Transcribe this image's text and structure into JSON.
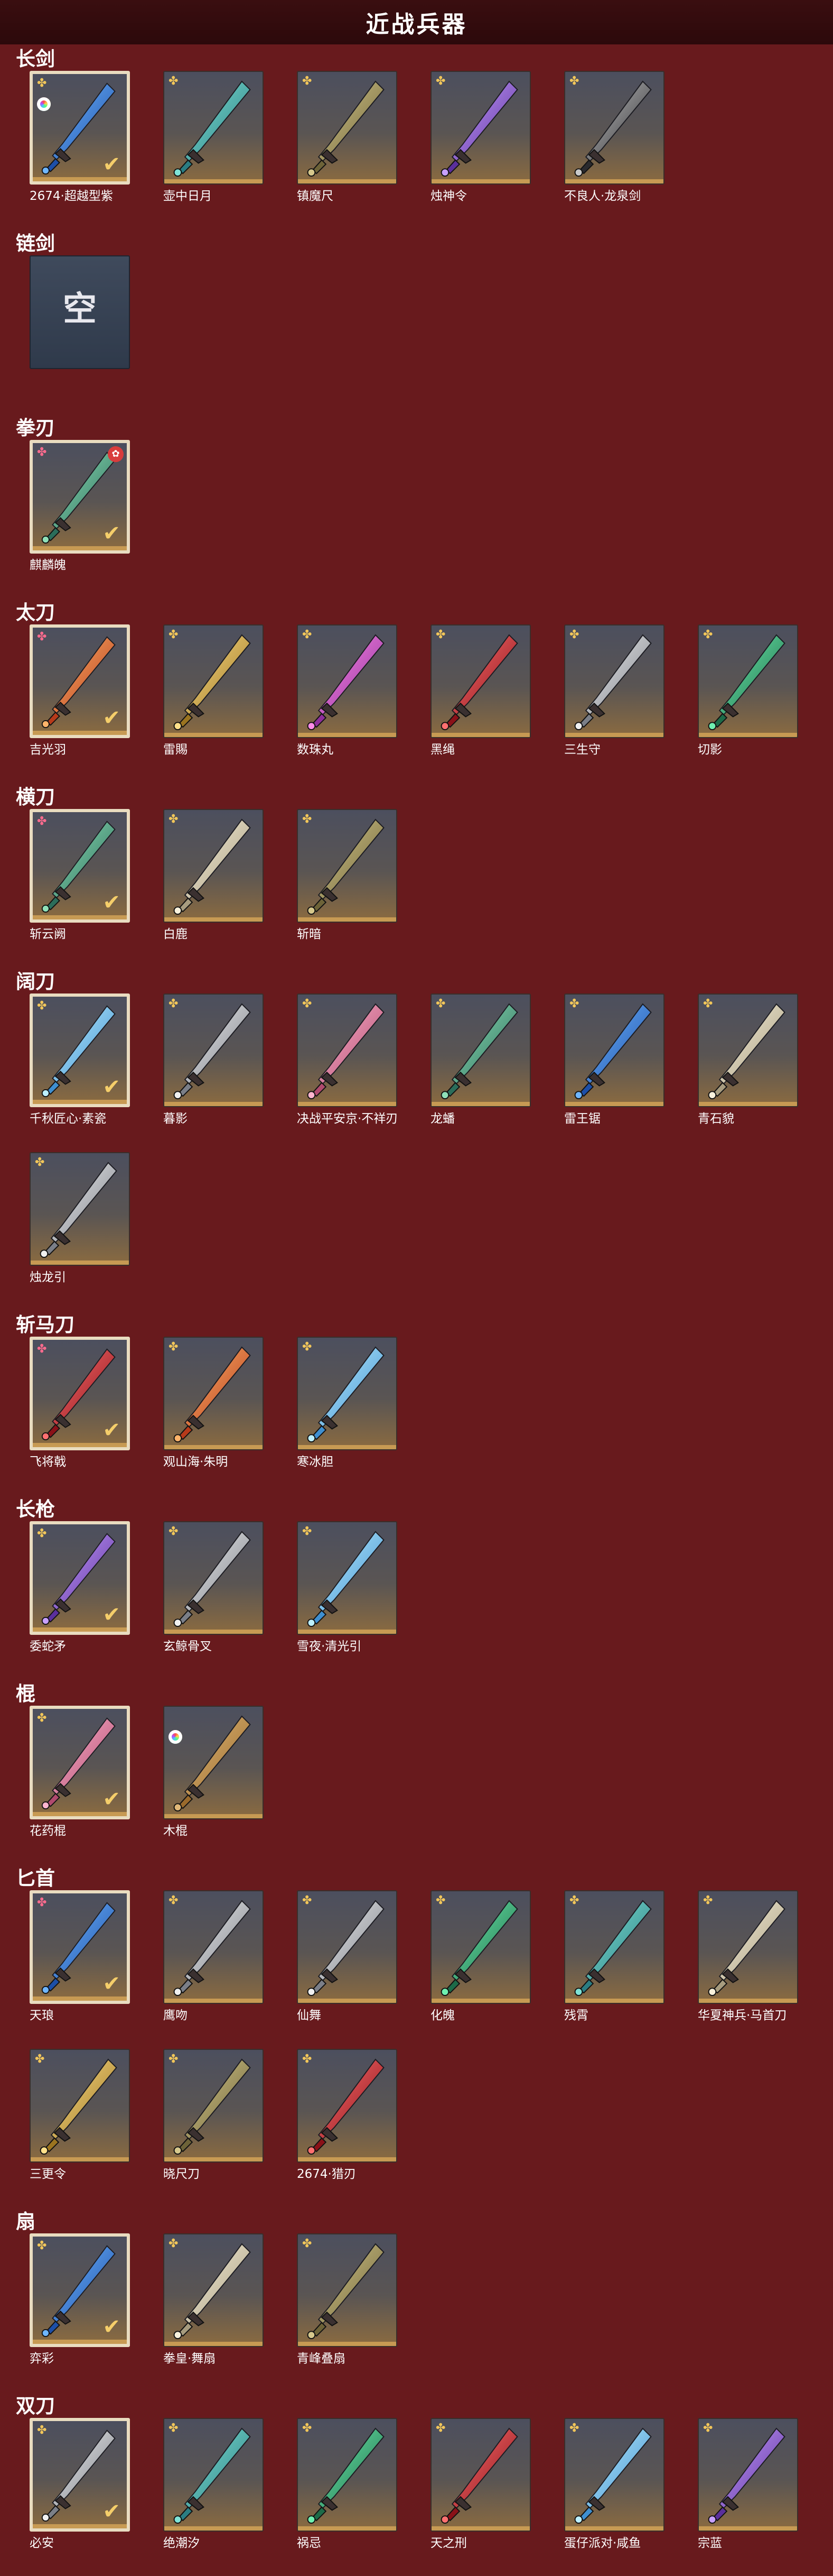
{
  "header": {
    "title": "近战兵器"
  },
  "colors": {
    "background": "#681a1d",
    "header": "#2c090b",
    "card_base": "#c79a53",
    "check": "#f5ce6a",
    "rarity_gold": "#f1c65a",
    "rarity_red": "#ff6b8e"
  },
  "categories": [
    {
      "title": "长剑",
      "items": [
        {
          "name": "2674·超越型紫",
          "rarity": "gold",
          "selected": true,
          "badge": "rainbow-left",
          "palette": "blue"
        },
        {
          "name": "壶中日月",
          "rarity": "gold",
          "palette": "teal"
        },
        {
          "name": "镇魔尺",
          "rarity": "gold",
          "palette": "olive"
        },
        {
          "name": "烛神令",
          "rarity": "gold",
          "palette": "violet"
        },
        {
          "name": "不良人·龙泉剑",
          "rarity": "gold",
          "palette": "dark"
        }
      ]
    },
    {
      "title": "链剑",
      "items": [
        {
          "name": "",
          "empty": true,
          "empty_text": "空"
        }
      ]
    },
    {
      "title": "拳刃",
      "items": [
        {
          "name": "麒麟魄",
          "rarity": "red",
          "selected": true,
          "badge": "limited",
          "palette": "jade"
        }
      ]
    },
    {
      "title": "太刀",
      "items": [
        {
          "name": "吉光羽",
          "rarity": "red",
          "selected": true,
          "palette": "fire"
        },
        {
          "name": "雷賜",
          "rarity": "gold",
          "palette": "gold"
        },
        {
          "name": "数珠丸",
          "rarity": "gold",
          "palette": "magenta"
        },
        {
          "name": "黑绳",
          "rarity": "gold",
          "palette": "crimson"
        },
        {
          "name": "三生守",
          "rarity": "gold",
          "palette": "silver"
        },
        {
          "name": "切影",
          "rarity": "gold",
          "palette": "emerald"
        }
      ]
    },
    {
      "title": "横刀",
      "items": [
        {
          "name": "斩云阙",
          "rarity": "red",
          "selected": true,
          "palette": "jade"
        },
        {
          "name": "白鹿",
          "rarity": "gold",
          "palette": "ivory"
        },
        {
          "name": "斩暗",
          "rarity": "gold",
          "palette": "olive"
        }
      ]
    },
    {
      "title": "阔刀",
      "items": [
        {
          "name": "千秋匠心·素瓷",
          "rarity": "gold",
          "selected": true,
          "palette": "ice"
        },
        {
          "name": "暮影",
          "rarity": "gold",
          "palette": "silver"
        },
        {
          "name": "决战平安京·不祥刃",
          "rarity": "gold",
          "palette": "pink"
        },
        {
          "name": "龙蟠",
          "rarity": "gold",
          "palette": "jade"
        },
        {
          "name": "雷王锯",
          "rarity": "gold",
          "palette": "blue"
        },
        {
          "name": "青石貌",
          "rarity": "gold",
          "palette": "ivory"
        },
        {
          "name": "烛龙引",
          "rarity": "gold",
          "palette": "silver"
        }
      ]
    },
    {
      "title": "斩马刀",
      "items": [
        {
          "name": "飞将戟",
          "rarity": "red",
          "selected": true,
          "palette": "crimson"
        },
        {
          "name": "观山海·朱明",
          "rarity": "gold",
          "palette": "fire"
        },
        {
          "name": "寒冰胆",
          "rarity": "gold",
          "palette": "ice"
        }
      ]
    },
    {
      "title": "长枪",
      "items": [
        {
          "name": "委蛇矛",
          "rarity": "gold",
          "selected": true,
          "palette": "violet"
        },
        {
          "name": "玄鲸骨叉",
          "rarity": "gold",
          "palette": "silver"
        },
        {
          "name": "雪夜·清光引",
          "rarity": "gold",
          "palette": "ice"
        }
      ]
    },
    {
      "title": "棍",
      "items": [
        {
          "name": "花药棍",
          "rarity": "gold",
          "selected": true,
          "palette": "pink"
        },
        {
          "name": "木棍",
          "rarity": "none",
          "badge": "rainbow-left",
          "palette": "wood"
        }
      ]
    },
    {
      "title": "匕首",
      "items": [
        {
          "name": "天琅",
          "rarity": "red",
          "selected": true,
          "palette": "blue"
        },
        {
          "name": "鹰吻",
          "rarity": "gold",
          "palette": "silver"
        },
        {
          "name": "仙舞",
          "rarity": "gold",
          "palette": "silver"
        },
        {
          "name": "化魄",
          "rarity": "gold",
          "palette": "emerald"
        },
        {
          "name": "残霄",
          "rarity": "gold",
          "palette": "teal"
        },
        {
          "name": "华夏神兵·马首刀",
          "rarity": "gold",
          "palette": "ivory"
        },
        {
          "name": "三更令",
          "rarity": "gold",
          "palette": "gold"
        },
        {
          "name": "晓尺刀",
          "rarity": "gold",
          "palette": "olive"
        },
        {
          "name": "2674·猎刃",
          "rarity": "gold",
          "palette": "crimson"
        }
      ]
    },
    {
      "title": "扇",
      "items": [
        {
          "name": "弈彩",
          "rarity": "gold",
          "selected": true,
          "palette": "blue"
        },
        {
          "name": "拳皇·舞扇",
          "rarity": "gold",
          "palette": "ivory"
        },
        {
          "name": "青峰叠扇",
          "rarity": "gold",
          "palette": "olive"
        }
      ]
    },
    {
      "title": "双刀",
      "items": [
        {
          "name": "必安",
          "rarity": "gold",
          "selected": true,
          "palette": "silver"
        },
        {
          "name": "绝潮汐",
          "rarity": "gold",
          "palette": "teal"
        },
        {
          "name": "祸忌",
          "rarity": "gold",
          "palette": "emerald"
        },
        {
          "name": "天之刑",
          "rarity": "gold",
          "palette": "crimson"
        },
        {
          "name": "蛋仔派对·咸鱼",
          "rarity": "gold",
          "palette": "ice"
        },
        {
          "name": "宗蓝",
          "rarity": "gold",
          "palette": "violet"
        }
      ]
    }
  ],
  "icons": {
    "rarity_gold": "flower-icon",
    "rarity_red": "flower-icon",
    "check": "check-icon"
  }
}
